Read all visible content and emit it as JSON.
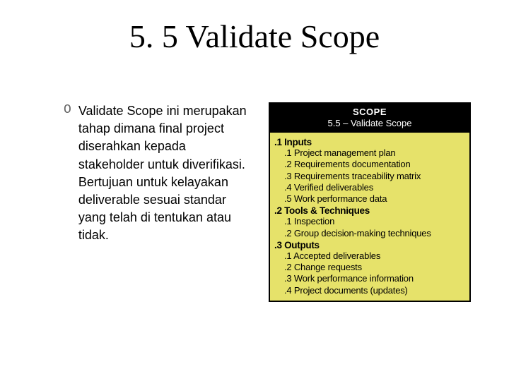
{
  "title": "5. 5 Validate Scope",
  "bullet_marker": "O",
  "bullet_text": "Validate Scope ini merupakan tahap dimana final project diserahkan kepada stakeholder untuk diverifikasi. Bertujuan untuk kelayakan deliverable sesuai standar yang telah di tentukan atau tidak.",
  "process_box": {
    "header_top": "SCOPE",
    "header_sub": "5.5 – Validate Scope",
    "sections": [
      {
        "heading": ".1 Inputs",
        "items": [
          ".1 Project management plan",
          ".2 Requirements documentation",
          ".3 Requirements traceability matrix",
          ".4 Verified deliverables",
          ".5 Work performance data"
        ]
      },
      {
        "heading": ".2 Tools & Techniques",
        "items": [
          ".1 Inspection",
          ".2 Group decision-making techniques"
        ]
      },
      {
        "heading": ".3 Outputs",
        "items": [
          ".1 Accepted deliverables",
          ".2 Change requests",
          ".3 Work performance information",
          ".4 Project documents (updates)"
        ]
      }
    ]
  }
}
